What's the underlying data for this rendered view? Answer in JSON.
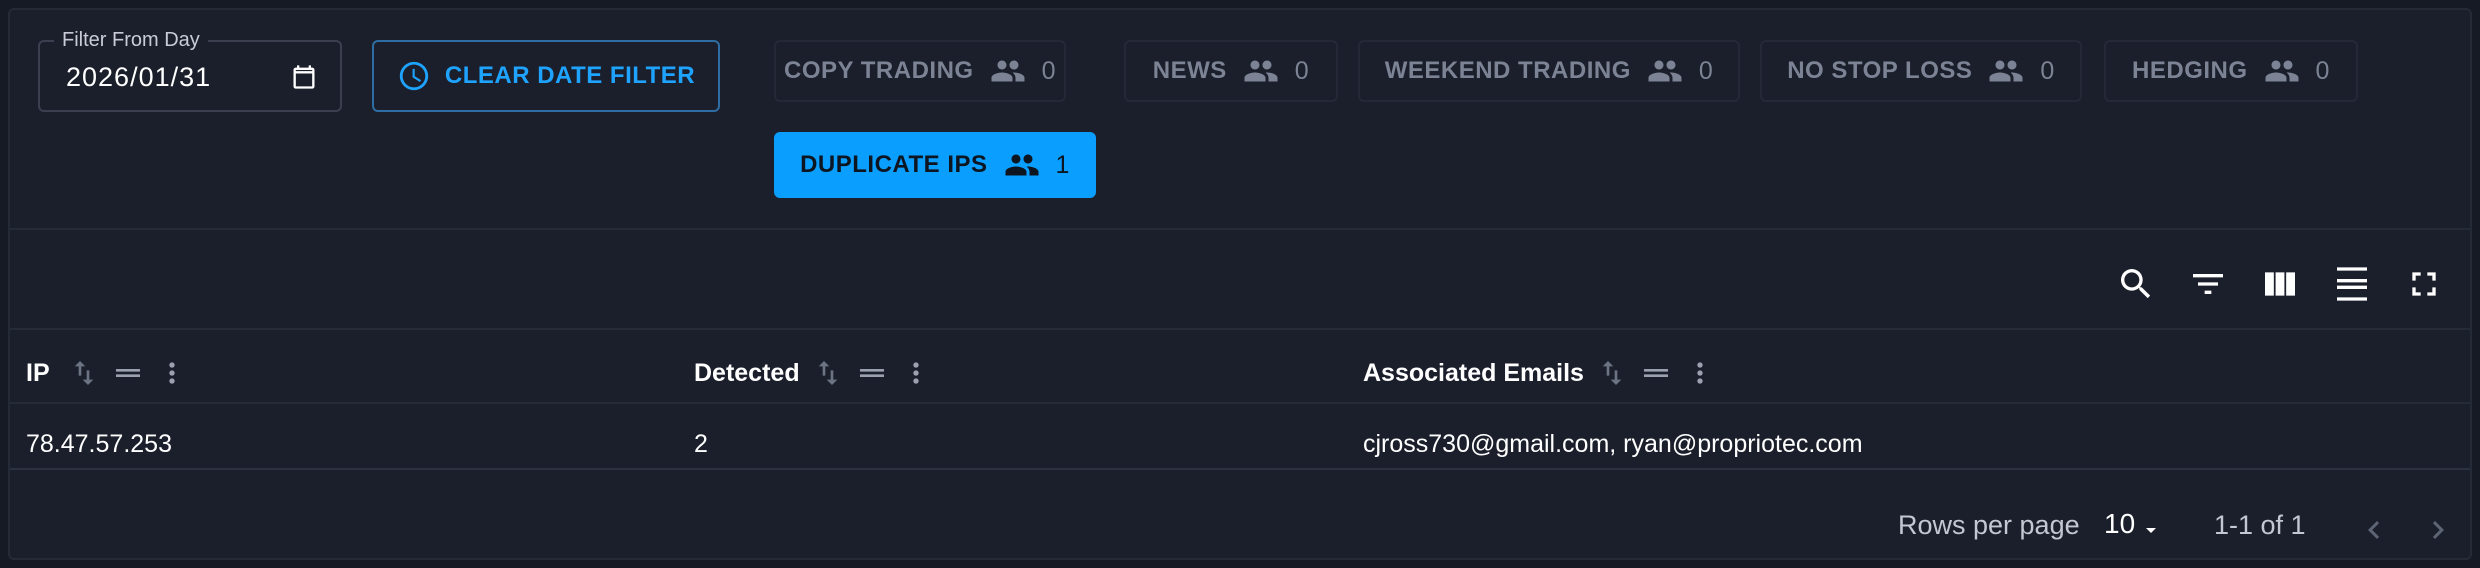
{
  "filters": {
    "date_label": "Filter From Day",
    "date_value": "2026/01/31",
    "clear_label": "CLEAR DATE FILTER",
    "chips": [
      {
        "label": "COPY TRADING",
        "count": "0",
        "active": false
      },
      {
        "label": "NEWS",
        "count": "0",
        "active": false
      },
      {
        "label": "WEEKEND TRADING",
        "count": "0",
        "active": false
      },
      {
        "label": "NO STOP LOSS",
        "count": "0",
        "active": false
      },
      {
        "label": "HEDGING",
        "count": "0",
        "active": false
      },
      {
        "label": "DUPLICATE IPS",
        "count": "1",
        "active": true
      }
    ]
  },
  "toolbar": {
    "icons": [
      "search-icon",
      "filter-icon",
      "columns-icon",
      "density-icon",
      "fullscreen-icon"
    ]
  },
  "table": {
    "columns": [
      "IP",
      "Detected",
      "Associated Emails"
    ],
    "rows": [
      [
        "78.47.57.253",
        "2",
        "cjross730@gmail.com, ryan@propriotec.com"
      ]
    ]
  },
  "pagination": {
    "rows_per_page_label": "Rows per page",
    "rows_per_page_value": "10",
    "range_text": "1-1 of 1"
  },
  "colors": {
    "accent": "#0a9eff",
    "background": "#1b1f2b",
    "chip_text": "#7c8394"
  }
}
